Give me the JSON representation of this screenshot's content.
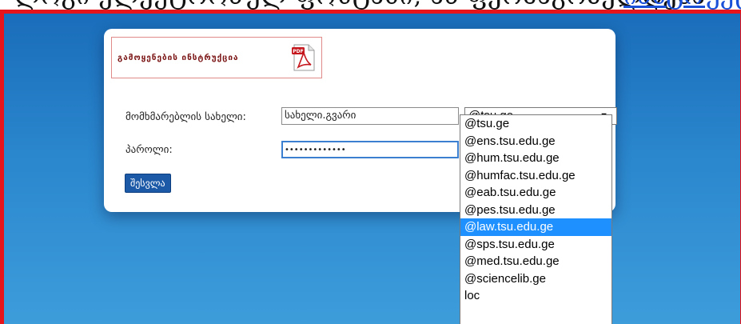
{
  "header": {
    "cut_text": "ლოგი  ელექტრონულ ფოსტაში, ან ფერმაგრძელდება",
    "cut_link": "ინსტრუქცია"
  },
  "card": {
    "guide_label": "გამოყენების ინსტრუქცია",
    "pdf_icon": "pdf-document-icon",
    "username_label": "მომხმარებლის სახელი:",
    "username_value": "სახელი.გვარი",
    "password_label": "პაროლი:",
    "password_value": "•••••••••••••",
    "domain_selected": "@tsu.ge",
    "login_label": "შესვლა"
  },
  "dropdown": {
    "options": [
      "@tsu.ge",
      "@ens.tsu.edu.ge",
      "@hum.tsu.edu.ge",
      "@humfac.tsu.edu.ge",
      "@eab.tsu.edu.ge",
      "@pes.tsu.edu.ge",
      "@law.tsu.edu.ge",
      "@sps.tsu.edu.ge",
      "@med.tsu.edu.ge",
      "@sciencelib.ge",
      "loc"
    ],
    "highlighted_index": 6
  },
  "colors": {
    "frame": "#e8141b",
    "accent": "#1c5aa8",
    "highlight": "#1e90ff"
  }
}
